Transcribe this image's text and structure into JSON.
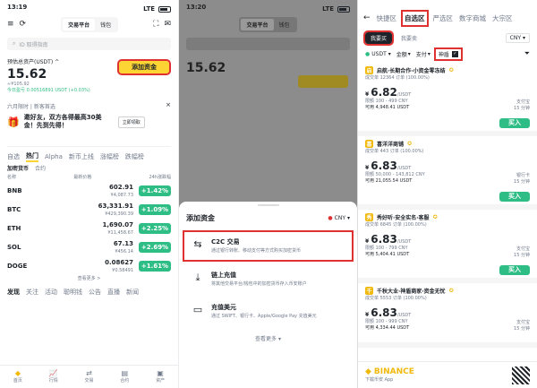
{
  "p1": {
    "status": {
      "time": "13:19",
      "net": "LTE"
    },
    "seg": [
      "交易平台",
      "钱包"
    ],
    "search_ph": "ID 取得指南",
    "asset": {
      "label": "预估总资产(USDT) ^",
      "value": "15.62",
      "sub": "≈¥105.92",
      "pnl": "今日盈亏 0.00516891 USDT (+0.03%)",
      "add": "添加资金"
    },
    "promo": {
      "tag": "六月限时 | 新客首选",
      "text": "邀好友，双方各得最高30美金！先到先得！",
      "btn": "立即领取"
    },
    "tabs": [
      "自选",
      "热门",
      "Alpha",
      "新币上线",
      "涨幅榜",
      "跌幅榜"
    ],
    "sub": [
      "加密货币",
      "合约"
    ],
    "cols": [
      "名称",
      "最新价格",
      "24h涨跌幅"
    ],
    "coins": [
      {
        "n": "BNB",
        "p": "602.91",
        "f": "¥4,087.73",
        "c": "+1.42%"
      },
      {
        "n": "BTC",
        "p": "63,331.91",
        "f": "¥429,390.39",
        "c": "+1.09%"
      },
      {
        "n": "ETH",
        "p": "1,690.07",
        "f": "¥11,458.67",
        "c": "+2.25%"
      },
      {
        "n": "SOL",
        "p": "67.13",
        "f": "¥456.14",
        "c": "+2.69%"
      },
      {
        "n": "DOGE",
        "p": "0.08627",
        "f": "¥0.58491",
        "c": "+1.61%"
      }
    ],
    "more": "查看更多 >",
    "feed": [
      "发现",
      "关注",
      "活动",
      "聪明钱",
      "公告",
      "直播",
      "新闻"
    ],
    "nav": [
      "首页",
      "行情",
      "交易",
      "合约",
      "资产"
    ]
  },
  "p2": {
    "status": {
      "time": "13:20",
      "net": "LTE"
    },
    "seg": [
      "交易平台",
      "钱包"
    ],
    "asset_value": "15.62",
    "sheet_title": "添加资金",
    "currency": "CNY",
    "options": [
      {
        "t": "C2C 交易",
        "d": "通过银行转账、移动支付等方式购买加密货币"
      },
      {
        "t": "链上充值",
        "d": "将其他交易平台/钱包中的加密货币存入币安账户"
      },
      {
        "t": "充值美元",
        "d": "通过 SWIFT、银行卡、Apple/Google Pay 充值美元"
      }
    ],
    "more": "查看更多"
  },
  "p3": {
    "top_tabs": [
      "快捷区",
      "自选区",
      "严选区",
      "数字商城",
      "大宗区"
    ],
    "sub_tabs": [
      "我要买",
      "我要卖"
    ],
    "currency": "CNY",
    "filters": [
      "USDT",
      "金额",
      "支付",
      "神盾"
    ],
    "ads": [
      {
        "merchant": "启航·长期合作·小资金零冻结",
        "meta": "成交单 12364 订单 (100.00%)",
        "price": "6.82",
        "unit": "/USDT",
        "lim1": "限额 100 - 499 CNY",
        "lim2": "可用 4,948.41 USDT",
        "pay": "支付宝",
        "time": "15 分钟",
        "buy": "买入"
      },
      {
        "merchant": "喜洋洋商铺",
        "meta": "成交单 443 订单 (100.00%)",
        "price": "6.83",
        "unit": "/USDT",
        "lim1": "限额 50,000 - 143,812 CNY",
        "lim2": "可用 21,055.54 USDT",
        "pay": "银行卡",
        "time": "15 分钟",
        "buy": "买入"
      },
      {
        "merchant": "秀好听·安全实名·客服",
        "meta": "成交单 6845 订单 (100.00%)",
        "price": "6.83",
        "unit": "/USDT",
        "lim1": "限额 100 - 799 CNY",
        "lim2": "可用 5,404.41 USDT",
        "pay": "支付宝",
        "time": "15 分钟",
        "buy": "买入"
      },
      {
        "merchant": "千秋大业·神盾商家·资金无忧",
        "meta": "成交单 5553 订单 (100.00%)",
        "price": "6.83",
        "unit": "/USDT",
        "lim1": "限额 100 - 999 CNY",
        "lim2": "可用 4,334.44 USDT",
        "pay": "支付宝",
        "time": "15 分钟",
        "buy": "买入"
      }
    ],
    "brand": "BINANCE",
    "brand_sub": "下载币安 App"
  }
}
